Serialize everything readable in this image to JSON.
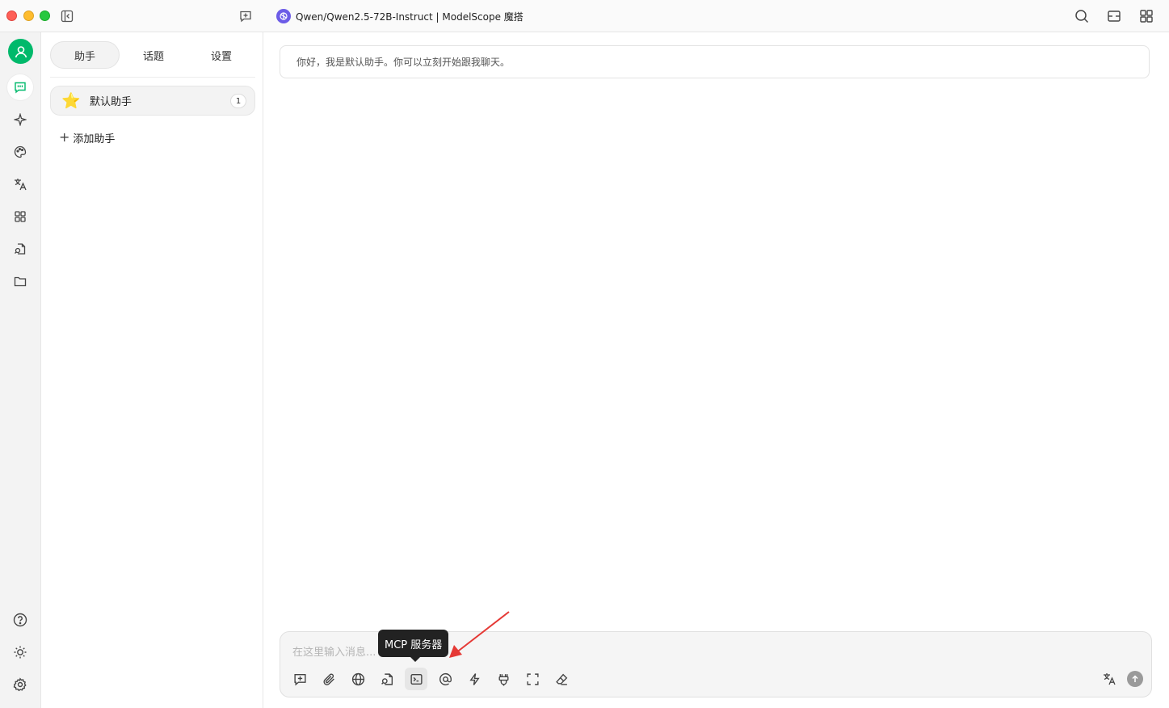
{
  "titlebar": {
    "title": "Qwen/Qwen2.5-72B-Instruct | ModelScope 魔搭"
  },
  "rail": {
    "items": [
      "chat-icon",
      "sparkle-icon",
      "palette-icon",
      "translate-icon",
      "apps-icon",
      "file-search-icon",
      "folder-icon"
    ],
    "bottom_items": [
      "help-icon",
      "theme-icon",
      "settings-icon"
    ]
  },
  "sidebar": {
    "tabs": [
      {
        "label": "助手",
        "active": true
      },
      {
        "label": "话题",
        "active": false
      },
      {
        "label": "设置",
        "active": false
      }
    ],
    "assistants": [
      {
        "emoji": "⭐",
        "name": "默认助手",
        "count": "1"
      }
    ],
    "add_label": "添加助手"
  },
  "chat": {
    "welcome": "你好，我是默认助手。你可以立刻开始跟我聊天。"
  },
  "composer": {
    "placeholder": "在这里输入消息...",
    "tooltip": "MCP 服务器",
    "tools": [
      "new-topic-icon",
      "attachment-icon",
      "web-search-icon",
      "knowledge-icon",
      "mcp-terminal-icon",
      "mention-icon",
      "quick-phrase-icon",
      "plugin-icon",
      "fullscreen-icon",
      "eraser-icon"
    ]
  },
  "colors": {
    "accent": "#00b96b",
    "annotation": "#e53935"
  }
}
